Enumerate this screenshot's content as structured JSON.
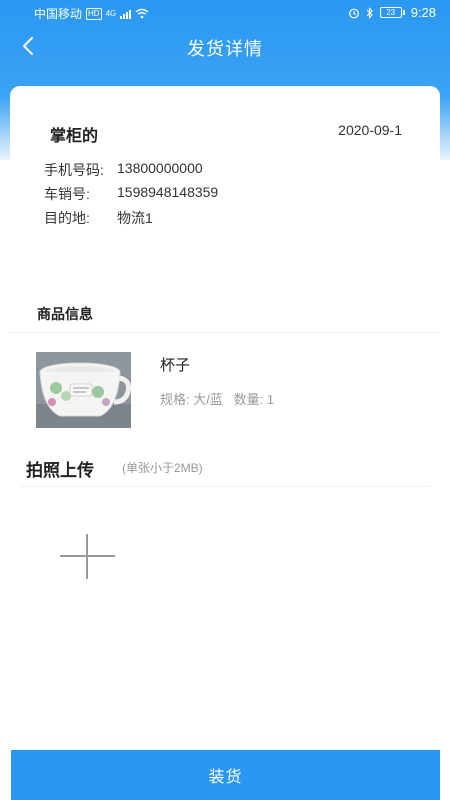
{
  "status_bar": {
    "carrier": "中国移动",
    "network_badge": "HD",
    "network_type": "4G",
    "battery": "23",
    "time": "9:28",
    "icons": [
      "signal-icon",
      "wifi-icon",
      "alarm-icon",
      "bluetooth-icon",
      "battery-icon"
    ]
  },
  "nav": {
    "title": "发货详情",
    "back_icon": "back-arrow-icon"
  },
  "order": {
    "buyer_name": "掌柜的",
    "date": "2020-09-1",
    "phone_label": "手机号码:",
    "phone": "13800000000",
    "sales_no_label": "车销号:",
    "sales_no": "1598948148359",
    "destination_label": "目的地:",
    "destination": "物流1"
  },
  "product_section": {
    "title": "商品信息",
    "product": {
      "name": "杯子",
      "spec": "规格: 大/蓝   数量: 1",
      "image": "cup-photo"
    }
  },
  "upload": {
    "title": "拍照上传",
    "hint": "(单张小于2MB)",
    "add_icon": "plus-icon"
  },
  "footer": {
    "load_label": "装货"
  },
  "colors": {
    "primary": "#2a97f2",
    "text_secondary": "#999999"
  }
}
